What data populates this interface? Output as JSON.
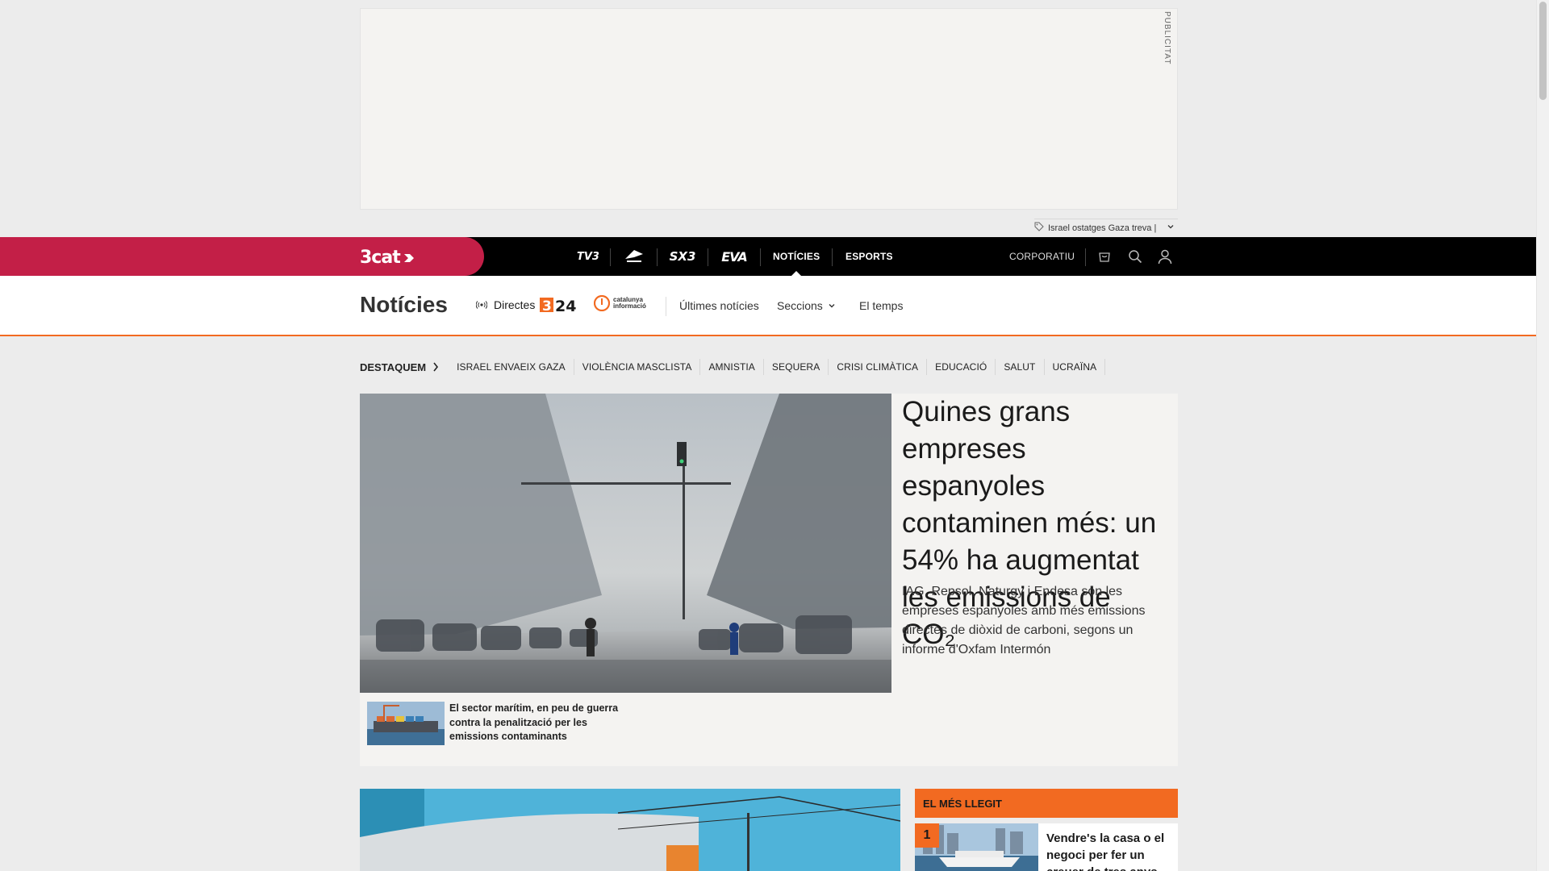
{
  "ad": {
    "label": "PUBLICITAT"
  },
  "trending": {
    "text": "Israel ostatges Gaza treva |"
  },
  "topbar": {
    "logo": "3cat",
    "channels": [
      "TV3",
      "Catràdio",
      "SX3",
      "EVA"
    ],
    "nav": [
      "NOTÍCIES",
      "ESPORTS"
    ],
    "corporate": "CORPORATIU"
  },
  "section": {
    "title": "Notícies",
    "directes": "Directes",
    "logo324": "3/24",
    "logo_ci": "catalunya informació",
    "links": [
      "Últimes notícies",
      "Seccions",
      "El temps"
    ]
  },
  "destaquem": {
    "title": "DESTAQUEM",
    "items": [
      "ISRAEL ENVAEIX GAZA",
      "VIOLÈNCIA MASCLISTA",
      "AMNISTIA",
      "SEQUERA",
      "CRISI CLIMÀTICA",
      "EDUCACIÓ",
      "SALUT",
      "UCRAÏNA"
    ]
  },
  "hero": {
    "title": "Quines grans empreses espanyoles contaminen més: un 54% ha augmentat les emissions de CO₂",
    "summary": "IAG, Repsol, Naturgy i Endesa són les empreses espanyoles amb més emissions directes de diòxid de carboni, segons un informe d'Oxfam Intermón",
    "related": "El sector marítim, en peu de guerra contra la penalització per les emissions contaminants"
  },
  "most_read": {
    "title": "EL MÉS LLEGIT",
    "items": [
      {
        "rank": "1",
        "title": "Vendre's la casa o el negoci per fer un creuer de tres anys"
      }
    ]
  },
  "colors": {
    "brand_red": "#c31f47",
    "accent_orange": "#f26a21",
    "topbar": "#000000"
  }
}
